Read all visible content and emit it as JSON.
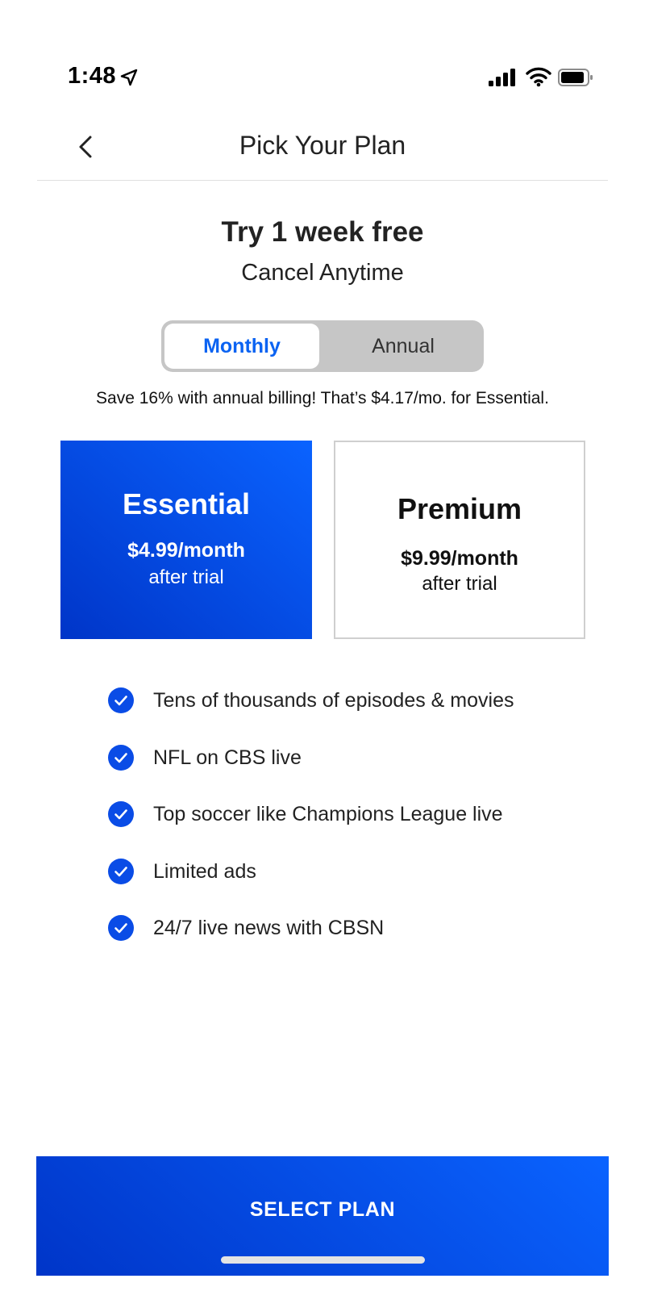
{
  "status_bar": {
    "time": "1:48",
    "icons": [
      "location-arrow-icon",
      "cellular-signal-icon",
      "wifi-icon",
      "battery-icon"
    ]
  },
  "header": {
    "title": "Pick Your Plan",
    "back_icon": "chevron-left-icon"
  },
  "trial": {
    "title": "Try 1 week free",
    "subtitle": "Cancel Anytime"
  },
  "billing_toggle": {
    "options": [
      "Monthly",
      "Annual"
    ],
    "selected": "Monthly"
  },
  "save_note": "Save 16% with annual billing! That’s $4.17/mo. for Essential.",
  "plans": [
    {
      "name": "Essential",
      "price": "$4.99/month",
      "after": "after trial",
      "selected": true
    },
    {
      "name": "Premium",
      "price": "$9.99/month",
      "after": "after trial",
      "selected": false
    }
  ],
  "features": [
    "Tens of thousands of episodes & movies",
    "NFL on CBS live",
    "Top soccer like Champions League live",
    "Limited ads",
    "24/7 live news with CBSN"
  ],
  "cta": {
    "label": "SELECT PLAN"
  },
  "colors": {
    "accent_blue": "#0a63ff",
    "deep_blue": "#0035c8",
    "toggle_bg": "#c6c6c6",
    "check_blue": "#0a4ce6"
  }
}
